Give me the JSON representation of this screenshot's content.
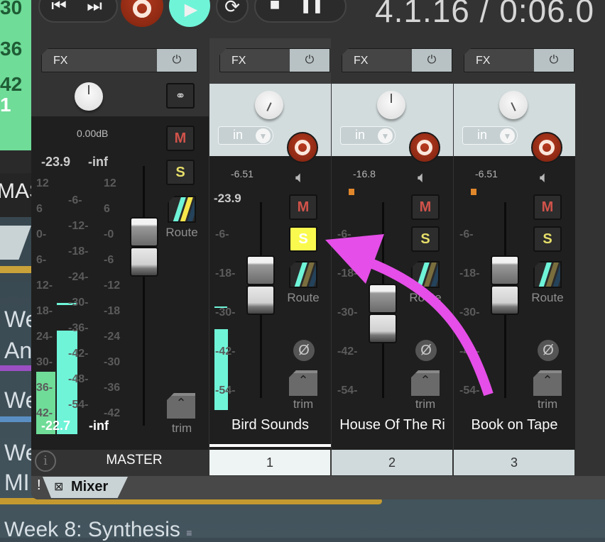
{
  "background": {
    "strip_numbers": [
      "30",
      "36",
      "42",
      "1"
    ],
    "left_fragments": [
      "MAS",
      "We",
      "An",
      "We",
      "We",
      "MI"
    ],
    "bottom_text": "Week 8: Synthesis",
    "bottom_icon": "menu-lines-icon",
    "accent_colors": {
      "gold": "#c9a23a",
      "purple": "#9b4fc2",
      "blue": "#5a8fc4"
    }
  },
  "transport": {
    "buttons": [
      {
        "name": "go-to-start",
        "icon": "skip-back-icon",
        "glyph": "⏮"
      },
      {
        "name": "go-to-end",
        "icon": "skip-forward-icon",
        "glyph": "⏭"
      },
      {
        "name": "record",
        "icon": "record-icon"
      },
      {
        "name": "play",
        "icon": "play-icon",
        "glyph": "▶"
      },
      {
        "name": "loop",
        "icon": "loop-icon",
        "glyph": "⟳"
      },
      {
        "name": "stop",
        "icon": "stop-icon",
        "glyph": "■"
      },
      {
        "name": "pause",
        "icon": "pause-icon",
        "glyph": "❚❚"
      }
    ],
    "timecode": "4.1.16 / 0:06.0",
    "play_color": "#6ff4d8",
    "record_color": "#a8321a"
  },
  "master": {
    "fx_label": "FX",
    "power_glyph": "⏻",
    "volume_db": "0.00dB",
    "peak_left": "-23.9",
    "peak_right": "-inf",
    "meter_left_value": "-22.7",
    "meter_right_value": "-inf",
    "mute_label": "M",
    "solo_label": "S",
    "route_label": "Route",
    "trim_label": "trim",
    "name": "MASTER",
    "info_glyph": "i",
    "mono_stereo_icon": "stereo-rings-icon",
    "scale_left": [
      "12",
      "6",
      "0-",
      "6-",
      "12-",
      "18-",
      "24-",
      "30-",
      "36-",
      "42-"
    ],
    "scale_mid": [
      "-6-",
      "-12-",
      "-18-",
      "-24-",
      "-30-",
      "-36-",
      "-42-",
      "-48-",
      "-54-"
    ],
    "scale_right": [
      "12",
      "6",
      "-0",
      "-6",
      "-12",
      "-18",
      "-24",
      "-30",
      "-36",
      "-42"
    ]
  },
  "tracks": [
    {
      "number": "1",
      "name": "Bird Sounds",
      "fx_label": "FX",
      "input": "in",
      "volume": "-6.51",
      "peak": "-23.9",
      "mute": "M",
      "solo": "S",
      "solo_active": true,
      "route": "Route",
      "trim": "trim",
      "phase": "Ø",
      "selected": true,
      "scale": [
        "-6-",
        "-18-",
        "-30-",
        "-42-",
        "-54-"
      ]
    },
    {
      "number": "2",
      "name": "House Of The Ri",
      "fx_label": "FX",
      "input": "in",
      "volume": "-16.8",
      "peak": "",
      "mute": "M",
      "solo": "S",
      "solo_active": false,
      "route": "Route",
      "trim": "trim",
      "phase": "Ø",
      "selected": false,
      "scale": [
        "-6-",
        "-18-",
        "-30-",
        "-42-",
        "-54-"
      ]
    },
    {
      "number": "3",
      "name": "Book on Tape",
      "fx_label": "FX",
      "input": "in",
      "volume": "-6.51",
      "peak": "",
      "mute": "M",
      "solo": "S",
      "solo_active": false,
      "route": "Route",
      "trim": "trim",
      "phase": "Ø",
      "selected": false,
      "scale": [
        "-6-",
        "-18-",
        "-30-",
        "-42-",
        "-54-"
      ]
    }
  ],
  "tab": {
    "warning": "!",
    "label": "Mixer",
    "close_glyph": "☒"
  },
  "annotation": {
    "type": "arrow",
    "color": "#e54ee8",
    "points_to": "track-1-solo-button"
  }
}
